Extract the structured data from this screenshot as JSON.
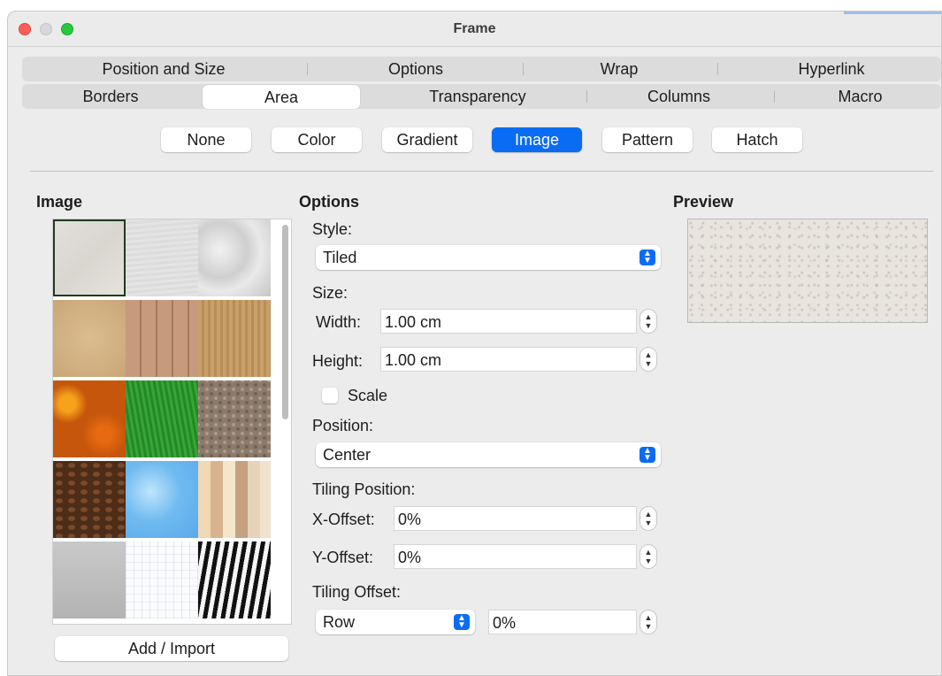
{
  "window": {
    "title": "Frame"
  },
  "tabs": {
    "row1": [
      "Position and Size",
      "Options",
      "Wrap",
      "Hyperlink"
    ],
    "row2": [
      "Borders",
      "Area",
      "Transparency",
      "Columns",
      "Macro"
    ],
    "active": "Area"
  },
  "fill_types": {
    "items": [
      "None",
      "Color",
      "Gradient",
      "Image",
      "Pattern",
      "Hatch"
    ],
    "selected": "Image"
  },
  "image_panel": {
    "title": "Image",
    "add_import_label": "Add / Import",
    "tiles": [
      "painted-white",
      "paper-texture",
      "crumpled-paper",
      "parchment",
      "wooden-board",
      "wood-grain",
      "autumn-leaves",
      "grass",
      "pebbles",
      "coffee-beans",
      "clouds",
      "color-stripes",
      "concrete",
      "grid-paper",
      "zebra"
    ],
    "selected_index": 0
  },
  "options": {
    "title": "Options",
    "style_label": "Style:",
    "style_value": "Tiled",
    "size_label": "Size:",
    "width_label": "Width:",
    "width_value": "1.00 cm",
    "height_label": "Height:",
    "height_value": "1.00 cm",
    "scale_label": "Scale",
    "scale_checked": false,
    "position_label": "Position:",
    "position_value": "Center",
    "tiling_position_label": "Tiling Position:",
    "x_offset_label": "X-Offset:",
    "x_offset_value": "0%",
    "y_offset_label": "Y-Offset:",
    "y_offset_value": "0%",
    "tiling_offset_label": "Tiling Offset:",
    "tiling_offset_type": "Row",
    "tiling_offset_value": "0%"
  },
  "preview": {
    "title": "Preview"
  },
  "colors": {
    "accent": "#0a6cf3"
  }
}
